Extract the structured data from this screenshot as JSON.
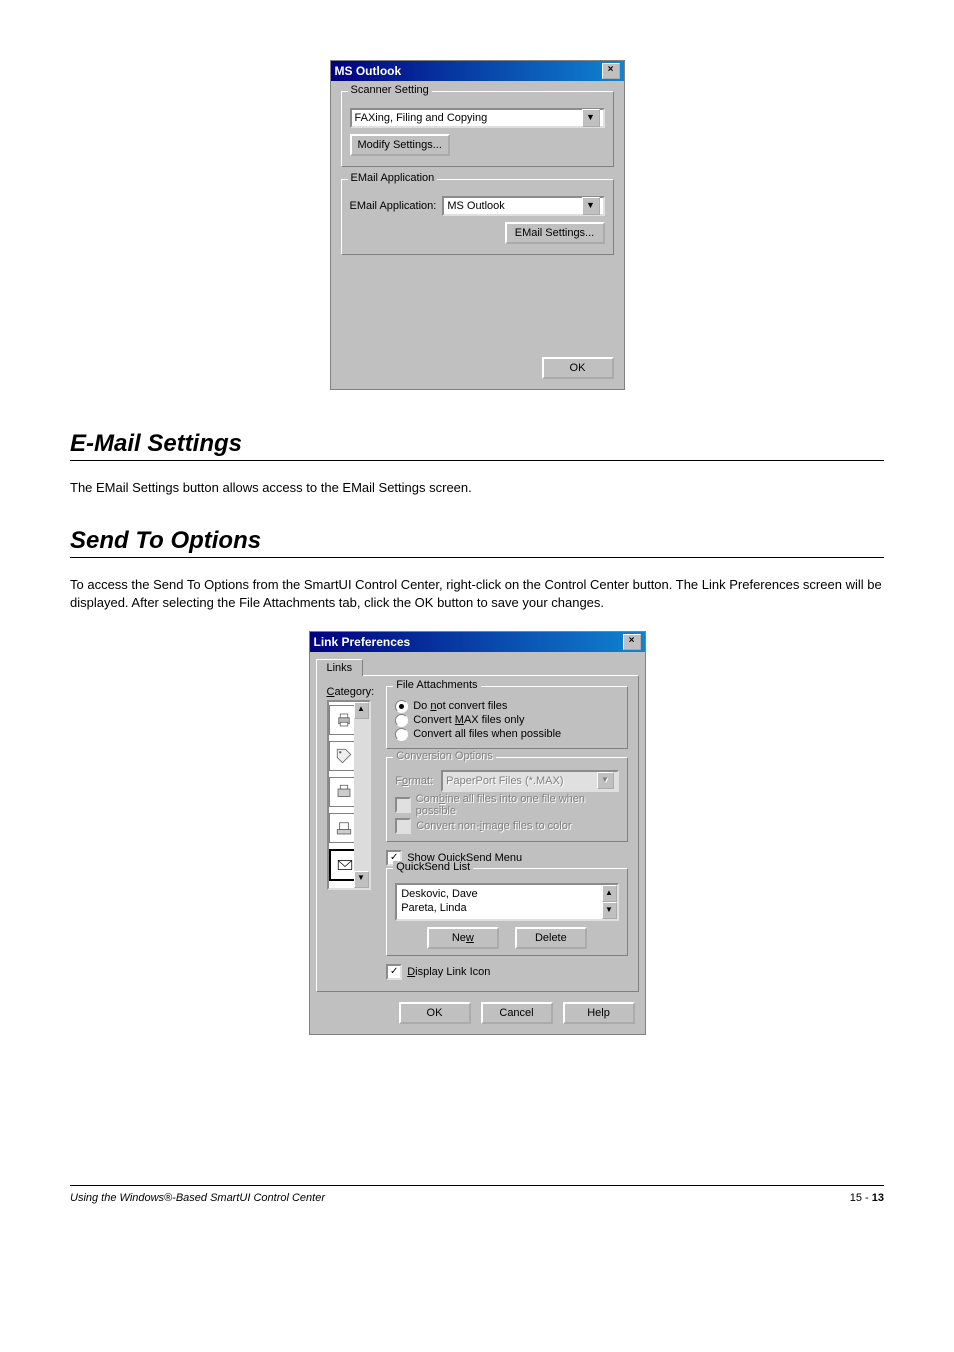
{
  "dialog1": {
    "title": "MS Outlook",
    "scanner_group": "Scanner Setting",
    "scanner_value": "FAXing, Filing and Copying",
    "modify_btn": "Modify Settings...",
    "email_group": "EMail Application",
    "email_label": "EMail Application:",
    "email_value": "MS Outlook",
    "email_settings_btn": "EMail Settings...",
    "ok": "OK"
  },
  "section_email_settings": {
    "heading": "E-Mail Settings",
    "body": "The EMail Settings button allows access to the EMail Settings screen."
  },
  "section_send_opts": {
    "heading": "Send To Options",
    "body": "To access the Send To Options from the SmartUI Control Center, right-click on the Control Center button. The Link Preferences screen will be displayed. After selecting the File Attachments tab, click the OK button to save your changes."
  },
  "dialog2": {
    "title": "Link Preferences",
    "tab": "Links",
    "category_label": "Category:",
    "category_u": "C",
    "file_attach_group": "File Attachments",
    "radios": {
      "no_convert": "Do not convert files",
      "no_convert_u": "n",
      "max_only": "Convert MAX files only",
      "max_only_u": "M",
      "all": "Convert all files when possible"
    },
    "conv_group": "Conversion Options",
    "format_label": "Format:",
    "format_label_u": "o",
    "format_value": "PaperPort Files (*.MAX)",
    "combine": "Combine all files into one file when possible",
    "combine_u": "b",
    "non_image": "Convert non-image files to color",
    "non_image_u": "i",
    "show_quick": "Show QuickSend Menu",
    "quick_group": "QuickSend List",
    "quick_names": [
      "Deskovic, Dave",
      "Pareta, Linda"
    ],
    "new_btn": "New",
    "new_btn_u": "w",
    "delete_btn": "Delete",
    "display_link": "Display Link Icon",
    "display_link_u": "D",
    "ok": "OK",
    "cancel": "Cancel",
    "help": "Help"
  },
  "footer": {
    "left": "Using the Windows®-Based SmartUI Control Center",
    "chapter": "15 - ",
    "page": "13"
  }
}
